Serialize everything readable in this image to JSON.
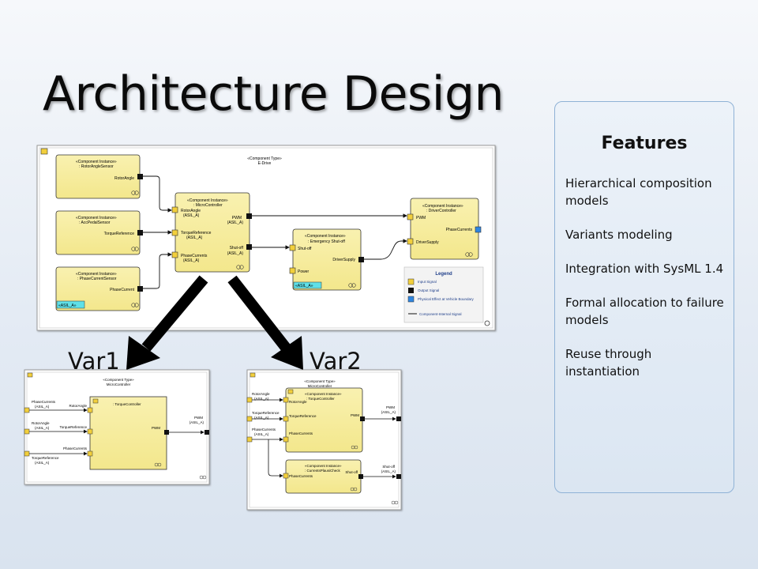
{
  "slide_title": "Architecture Design",
  "features": {
    "heading": "Features",
    "items": [
      "Hierarchical composition models",
      "Variants modeling",
      "Integration with SysML 1.4",
      "Formal allocation to failure models",
      "Reuse through instantiation"
    ]
  },
  "main_diagram": {
    "stereotype": "«Component Type»",
    "name": "E-Drive",
    "sensor1": {
      "line1": "«Component Instance»",
      "line2": ": RotorAngleSensor",
      "port": "RotorAngle"
    },
    "sensor2": {
      "line1": "«Component Instance»",
      "line2": ": AccPedalSensor",
      "port": "TorqueReference"
    },
    "sensor3": {
      "line1": "«Component Instance»",
      "line2": ": PhaseCurrentSensor",
      "port": "PhaseCurrent",
      "tag": "«ASIL_A»"
    },
    "mc": {
      "line1": "«Component Instance»",
      "line2": ": MicroController",
      "in1": "RotorAngle",
      "in1b": "(ASIL_A)",
      "in2": "TorqueReference",
      "in2b": "(ASIL_A)",
      "in3": "PhaseCurrents",
      "in3b": "(ASIL_A)",
      "out1": "PWM",
      "out1b": "(ASIL_A)",
      "out2": "Shut-off",
      "out2b": "(ASIL_A)"
    },
    "es": {
      "line1": "«Component Instance»",
      "line2": ": Emergency Shut-off",
      "in1": "Shut-off",
      "in2": "Power",
      "out": "DriverSupply",
      "tag": "«ASIL_A»"
    },
    "dc": {
      "line1": "«Component Instance»",
      "line2": ": DriverController",
      "in1": "PWM",
      "in2": "DriverSupply",
      "out": "PhaseCurrents"
    },
    "legend": {
      "title": "Legend",
      "input": "Input Signal",
      "output": "Output Signal",
      "physical": "Physical Effect at Vehicle Boundary",
      "internal": "Component-Internal Signal"
    }
  },
  "var1": {
    "label": "Var1",
    "stereotype": "«Component Type»",
    "name": "MicroController",
    "inner": ": TorqueController",
    "ext_in1": "PhaseCurrents",
    "ext_in1b": "(ASIL_A)",
    "ext_in2": "RotorAngle",
    "ext_in2b": "(ASIL_A)",
    "ext_in3": "TorqueReference",
    "ext_in3b": "(ASIL_A)",
    "port1": "RotorAngle",
    "port2": "TorqueReference",
    "port3": "PhaseCurrents",
    "inner_out": "PWM",
    "ext_out": "PWM",
    "ext_outb": "(ASIL_A)"
  },
  "var2": {
    "label": "Var2",
    "stereotype": "«Component Type»",
    "name": "MicroController",
    "ext_in1": "RotorAngle",
    "ext_in1b": "(ASIL_A)",
    "ext_in2": "TorqueReference",
    "ext_in2b": "(ASIL_A)",
    "ext_in3": "PhaseCurrents",
    "ext_in3b": "(ASIL_A)",
    "tc": {
      "line1": "«Component Instance»",
      "line2": ": TorqueController",
      "in1": "RotorAngle",
      "in2": "TorqueReference",
      "in3": "PhaseCurrents",
      "out": "PWM"
    },
    "cp": {
      "line1": "«Component Instance»",
      "line2": ": CurrentsPlausiCheck",
      "in1": "PhaseCurrents",
      "out": "Shut-off"
    },
    "ext_out1": "PWM",
    "ext_out1b": "(ASIL_A)",
    "ext_out2": "Shut-off",
    "ext_out2b": "(ASIL_A)"
  },
  "colors": {
    "component_fill": "#f7ec9a",
    "input_port": "#f2cf3c",
    "output_port": "#111111",
    "physical_port": "#2f86e0",
    "asil_tag": "#5fe0e8"
  }
}
